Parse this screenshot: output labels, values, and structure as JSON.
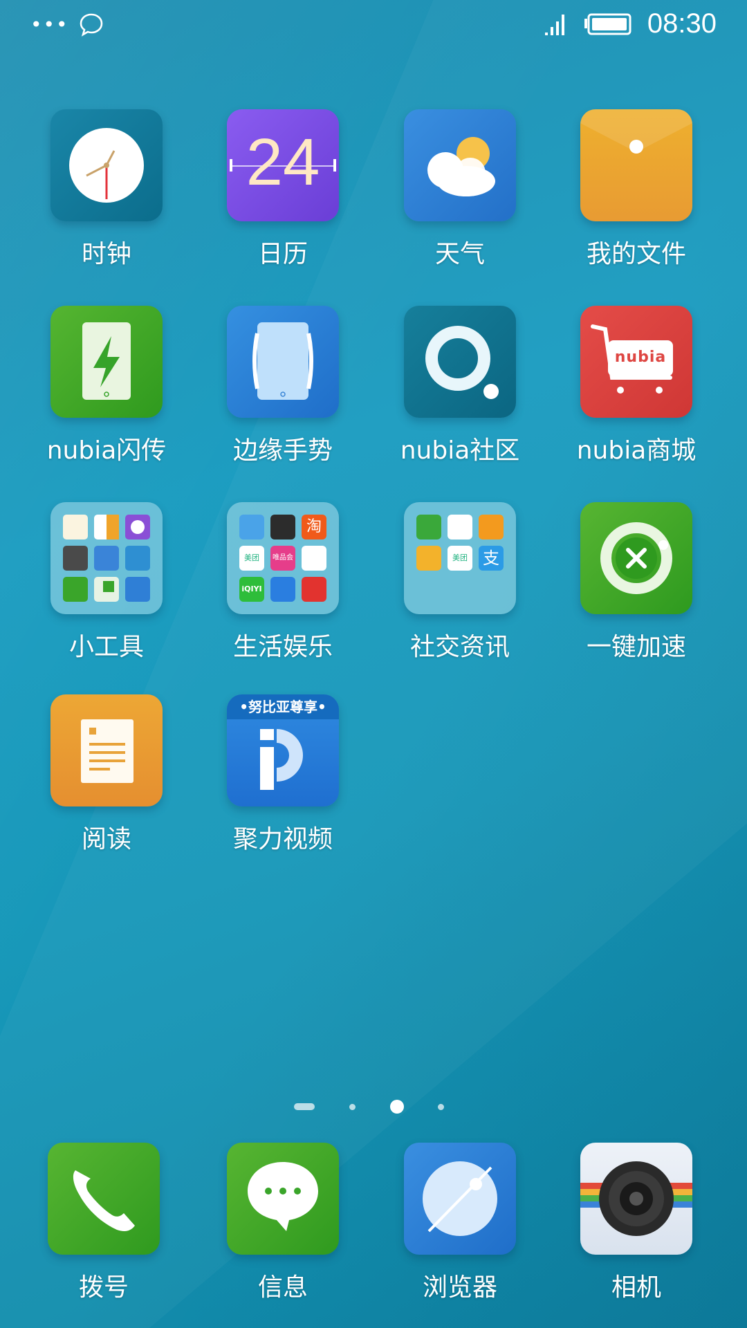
{
  "status_bar": {
    "time": "08:30",
    "left_icons": [
      "more-dots-icon",
      "chat-bubble-icon"
    ],
    "right_icons": [
      "signal-icon",
      "battery-icon"
    ]
  },
  "apps": [
    {
      "label": "时钟",
      "icon": "clock-icon"
    },
    {
      "label": "日历",
      "icon": "calendar-icon",
      "date": "24"
    },
    {
      "label": "天气",
      "icon": "weather-icon"
    },
    {
      "label": "我的文件",
      "icon": "folder-icon"
    },
    {
      "label": "nubia闪传",
      "icon": "flash-transfer-icon"
    },
    {
      "label": "边缘手势",
      "icon": "edge-gesture-icon"
    },
    {
      "label": "nubia社区",
      "icon": "community-icon"
    },
    {
      "label": "nubia商城",
      "icon": "shop-cart-icon",
      "brand": "nubia"
    },
    {
      "label": "小工具",
      "icon": "tools-folder-icon"
    },
    {
      "label": "生活娱乐",
      "icon": "life-folder-icon",
      "mini_labels": [
        "淘",
        "美团",
        "唯品会",
        "iQIYI"
      ]
    },
    {
      "label": "社交资讯",
      "icon": "social-folder-icon",
      "mini_labels": [
        "美团",
        "支"
      ]
    },
    {
      "label": "一键加速",
      "icon": "boost-icon"
    },
    {
      "label": "阅读",
      "icon": "reader-icon"
    },
    {
      "label": "聚力视频",
      "icon": "video-icon",
      "banner": "•努比亚尊享•"
    }
  ],
  "pages": {
    "count": 4,
    "current": 2
  },
  "dock": [
    {
      "label": "拨号",
      "icon": "phone-icon"
    },
    {
      "label": "信息",
      "icon": "message-icon"
    },
    {
      "label": "浏览器",
      "icon": "browser-icon"
    },
    {
      "label": "相机",
      "icon": "camera-icon"
    }
  ],
  "colors": {
    "clock": "#0b6d8c",
    "calendar": "#7d4fe0",
    "weather": "#2a7fd6",
    "files": "#f0a42a",
    "green": "#43a823",
    "blue": "#2f86de",
    "red": "#de4642",
    "orange": "#e89a33"
  }
}
